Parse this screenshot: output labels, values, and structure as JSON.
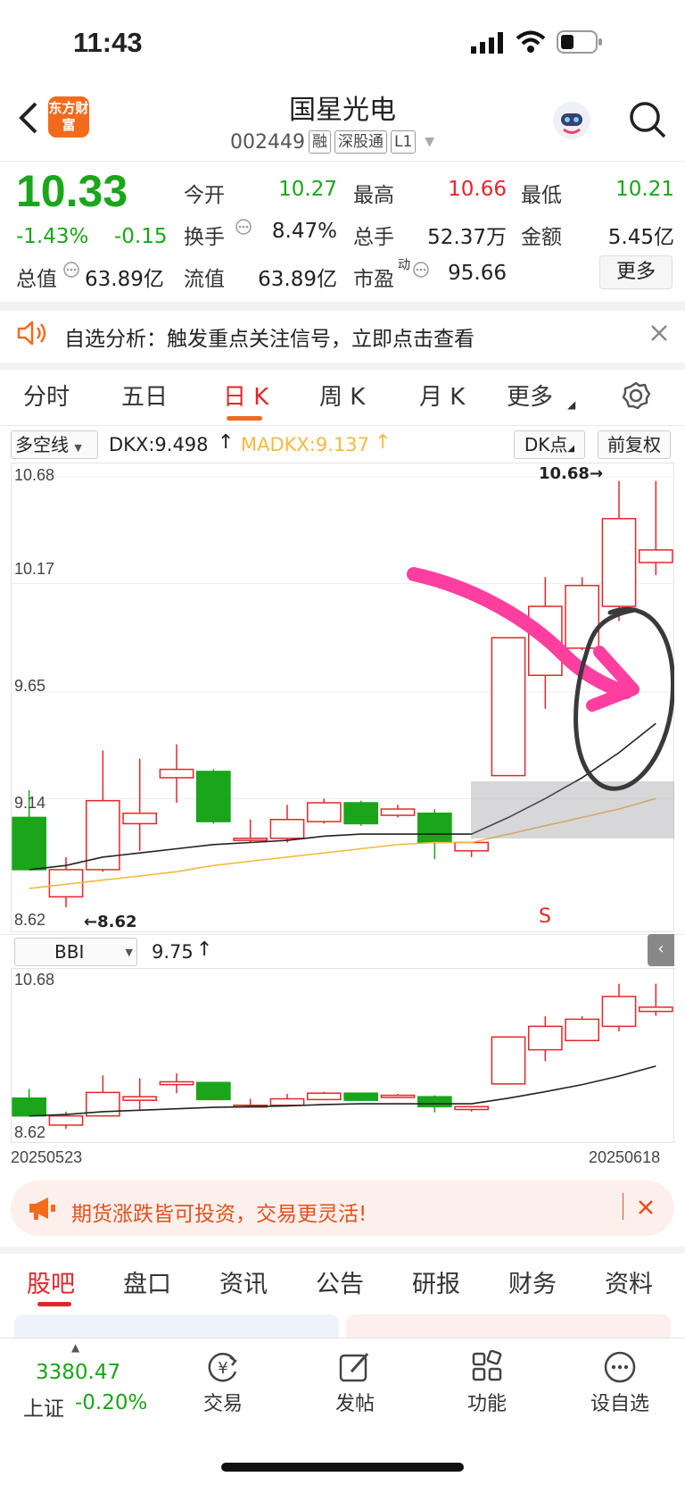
{
  "status_bar": {
    "time": "11:43"
  },
  "header": {
    "app_logo_text": "东方财富",
    "title": "国星光电",
    "code": "002449",
    "tags": [
      "融",
      "深股通",
      "L1"
    ]
  },
  "quote": {
    "price": "10.33",
    "change_pct": "-1.43%",
    "change": "-0.15",
    "total_value_label": "总值",
    "total_value": "63.89亿",
    "fields": [
      {
        "label": "今开",
        "value": "10.27",
        "color": "#1aa51a"
      },
      {
        "label": "最高",
        "value": "10.66",
        "color": "#e3262b"
      },
      {
        "label": "最低",
        "value": "10.21",
        "color": "#1aa51a"
      },
      {
        "label": "换手",
        "value": "8.47%",
        "color": "#222222"
      },
      {
        "label": "总手",
        "value": "52.37万",
        "color": "#222222"
      },
      {
        "label": "金额",
        "value": "5.45亿",
        "color": "#222222"
      },
      {
        "label": "流值",
        "value": "63.89亿",
        "color": "#222222"
      },
      {
        "label": "市盈",
        "label_sup": "动",
        "value": "95.66",
        "color": "#222222"
      }
    ],
    "more_label": "更多"
  },
  "notice": {
    "text": "自选分析：触发重点关注信号，立即点击查看"
  },
  "chart_tabs": [
    "分时",
    "五日",
    "日 K",
    "周 K",
    "月 K",
    "更多"
  ],
  "chart_tabs_active": 2,
  "indicator": {
    "select": "多空线",
    "dkx": "DKX:9.498",
    "madkx": "MADKX:9.137",
    "dk_button": "DK点",
    "adjust_button": "前复权"
  },
  "chart_data": {
    "type": "candlestick",
    "x_start": "20250523",
    "x_end": "20250618",
    "y_ticks": [
      "10.68",
      "10.17",
      "9.65",
      "9.14",
      "8.62"
    ],
    "ylim": [
      8.62,
      10.68
    ],
    "annotations": {
      "high": "10.68",
      "low": "8.62",
      "signal": "S"
    },
    "series_names": [
      "DKX",
      "MADKX"
    ],
    "candles": [
      {
        "o": 9.05,
        "c": 8.8,
        "h": 9.18,
        "l": 8.8
      },
      {
        "o": 8.67,
        "c": 8.8,
        "h": 8.86,
        "l": 8.62
      },
      {
        "o": 8.8,
        "c": 9.13,
        "h": 9.37,
        "l": 8.79
      },
      {
        "o": 9.02,
        "c": 9.07,
        "h": 9.33,
        "l": 8.89
      },
      {
        "o": 9.24,
        "c": 9.28,
        "h": 9.4,
        "l": 9.12
      },
      {
        "o": 9.27,
        "c": 9.03,
        "h": 9.28,
        "l": 9.02
      },
      {
        "o": 8.94,
        "c": 8.95,
        "h": 9.04,
        "l": 8.93
      },
      {
        "o": 8.95,
        "c": 9.04,
        "h": 9.11,
        "l": 8.93
      },
      {
        "o": 9.03,
        "c": 9.12,
        "h": 9.14,
        "l": 9.02
      },
      {
        "o": 9.12,
        "c": 9.02,
        "h": 9.13,
        "l": 9.01
      },
      {
        "o": 9.06,
        "c": 9.09,
        "h": 9.11,
        "l": 9.05
      },
      {
        "o": 9.07,
        "c": 8.93,
        "h": 9.09,
        "l": 8.85
      },
      {
        "o": 8.89,
        "c": 8.93,
        "h": 8.93,
        "l": 8.86
      },
      {
        "o": 9.25,
        "c": 9.91,
        "h": 9.91,
        "l": 9.25
      },
      {
        "o": 9.73,
        "c": 10.06,
        "h": 10.2,
        "l": 9.57
      },
      {
        "o": 9.86,
        "c": 10.16,
        "h": 10.2,
        "l": 9.85
      },
      {
        "o": 10.06,
        "c": 10.48,
        "h": 10.66,
        "l": 9.99
      },
      {
        "o": 10.27,
        "c": 10.33,
        "h": 10.66,
        "l": 10.21
      }
    ],
    "dkx": [
      8.8,
      8.82,
      8.86,
      8.88,
      8.9,
      8.92,
      8.93,
      8.94,
      8.96,
      8.97,
      8.97,
      8.97,
      8.97,
      9.05,
      9.14,
      9.24,
      9.36,
      9.5
    ],
    "madkx": [
      8.71,
      8.73,
      8.75,
      8.77,
      8.79,
      8.82,
      8.84,
      8.86,
      8.88,
      8.9,
      8.92,
      8.93,
      8.93,
      8.97,
      9.01,
      9.05,
      9.09,
      9.14
    ]
  },
  "sub_chart": {
    "select": "BBI",
    "value": "9.75",
    "y_top": "10.68",
    "y_bottom": "8.62"
  },
  "promo": {
    "text": "期货涨跌皆可投资，交易更灵活!"
  },
  "bottom_tabs": [
    "股吧",
    "盘口",
    "资讯",
    "公告",
    "研报",
    "财务",
    "资料"
  ],
  "bottom_tabs_active": 0,
  "navbar": {
    "index_value": "3380.47",
    "index_name": "上证",
    "index_change": "-0.20%",
    "items": [
      "交易",
      "发帖",
      "功能",
      "设自选"
    ]
  },
  "colors": {
    "up": "#e3262b",
    "down": "#1aa51a",
    "accent": "#f26b1d",
    "dkx": "#222222",
    "madkx": "#f5b942"
  }
}
